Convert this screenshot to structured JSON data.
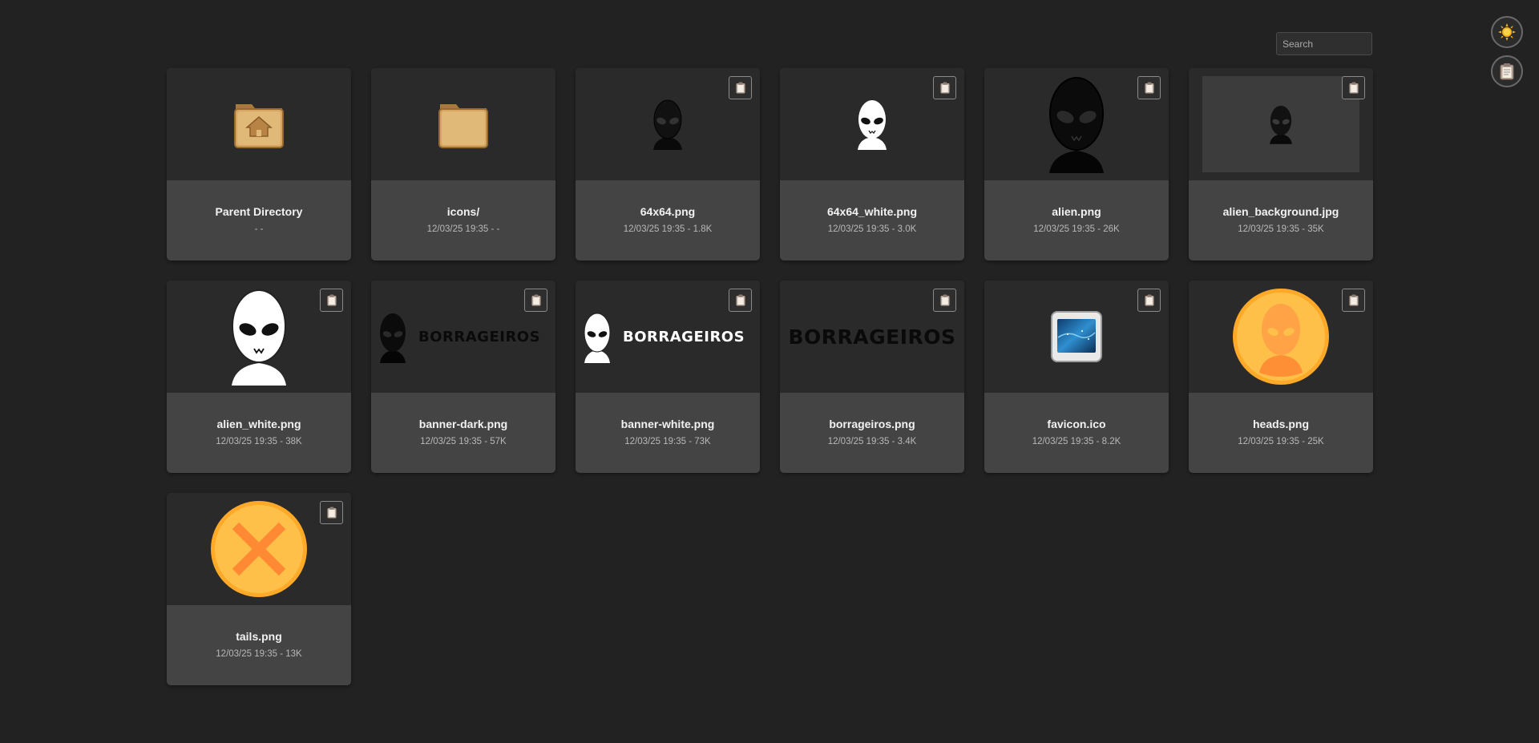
{
  "search": {
    "placeholder": "Search"
  },
  "buttons": {
    "theme_icon": "sun-icon",
    "clipboard_icon": "clipboard-icon"
  },
  "colors": {
    "background": "#222222",
    "card": "#444444",
    "thumb": "#2a2a2a",
    "folder": "#d6a55f",
    "coin": "#ffc04a",
    "coin_mark": "#ff8a33"
  },
  "entries": [
    {
      "name": "Parent Directory",
      "meta": "- -",
      "icon": "home-folder-icon"
    },
    {
      "name": "icons/",
      "meta": "12/03/25 19:35 - -",
      "icon": "folder-icon"
    },
    {
      "name": "64x64.png",
      "meta": "12/03/25 19:35 - 1.8K",
      "icon": "alien-dark-small-icon"
    },
    {
      "name": "64x64_white.png",
      "meta": "12/03/25 19:35 - 3.0K",
      "icon": "alien-white-small-icon"
    },
    {
      "name": "alien.png",
      "meta": "12/03/25 19:35 - 26K",
      "icon": "alien-dark-large-icon"
    },
    {
      "name": "alien_background.jpg",
      "meta": "12/03/25 19:35 - 35K",
      "icon": "alien-background-icon"
    },
    {
      "name": "alien_white.png",
      "meta": "12/03/25 19:35 - 38K",
      "icon": "alien-white-large-icon"
    },
    {
      "name": "banner-dark.png",
      "meta": "12/03/25 19:35 - 57K",
      "icon": "banner-dark-icon",
      "banner_text": "BORRAGEIROS"
    },
    {
      "name": "banner-white.png",
      "meta": "12/03/25 19:35 - 73K",
      "icon": "banner-white-icon",
      "banner_text": "BORRAGEIROS"
    },
    {
      "name": "borrageiros.png",
      "meta": "12/03/25 19:35 - 3.4K",
      "icon": "wordmark-icon",
      "banner_text": "BORRAGEIROS"
    },
    {
      "name": "favicon.ico",
      "meta": "12/03/25 19:35 - 8.2K",
      "icon": "favicon-icon"
    },
    {
      "name": "heads.png",
      "meta": "12/03/25 19:35 - 25K",
      "icon": "coin-heads-icon"
    },
    {
      "name": "tails.png",
      "meta": "12/03/25 19:35 - 13K",
      "icon": "coin-tails-icon"
    }
  ]
}
